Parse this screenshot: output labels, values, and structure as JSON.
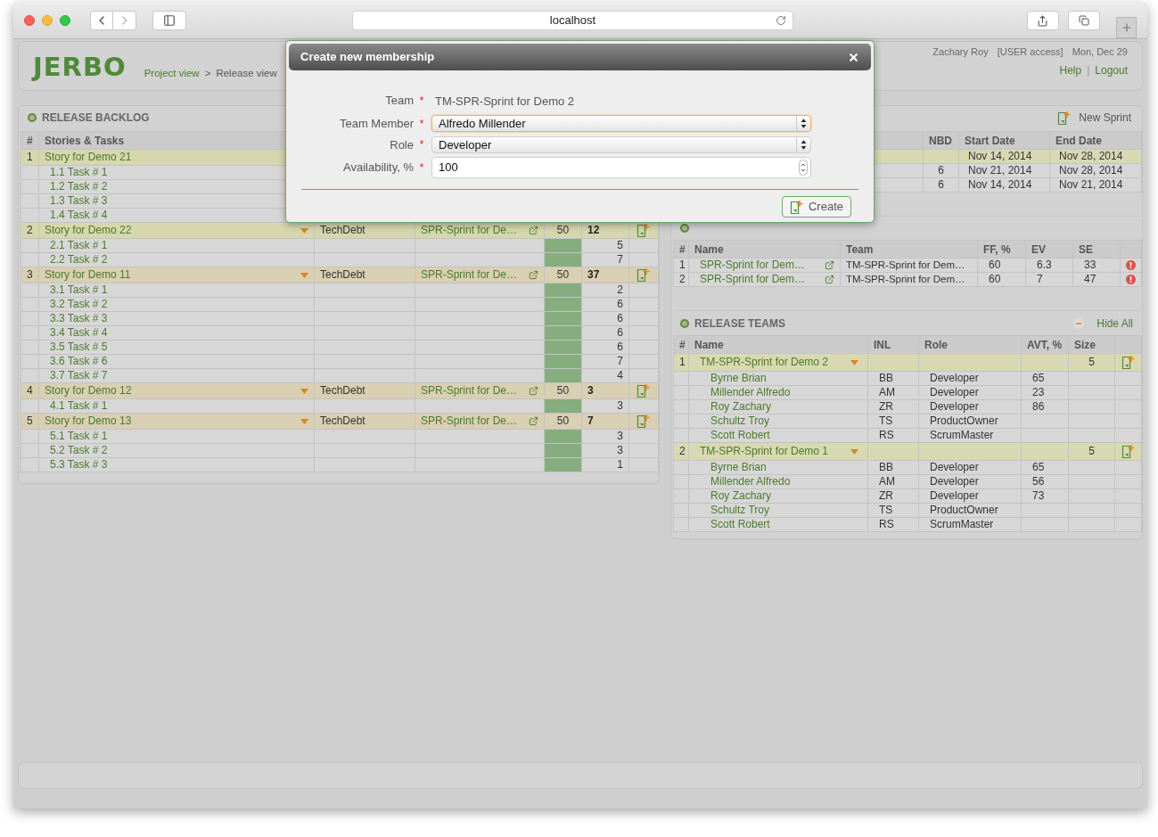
{
  "browser": {
    "address": "localhost"
  },
  "header": {
    "logo": "JERBO",
    "breadcrumb": [
      "Project view",
      "Release view"
    ],
    "breadcrumb_separator": ">",
    "user": "Zachary Roy",
    "access": "[USER access]",
    "date": "Mon, Dec 29",
    "links": [
      "Help",
      "Logout"
    ],
    "link_separator": "|"
  },
  "backlog": {
    "title": "RELEASE BACKLOG",
    "columns": [
      "#",
      "Stories & Tasks"
    ],
    "stories": [
      {
        "number": "1",
        "name": "Story for Demo 21",
        "color": "#d6d7ae",
        "tasks": [
          {
            "name": "1.1 Task # 1"
          },
          {
            "name": "1.2 Task # 2"
          },
          {
            "name": "1.3 Task # 3"
          },
          {
            "name": "1.4 Task # 4"
          }
        ]
      },
      {
        "number": "2",
        "name": "Story for Demo 22",
        "color": "#d6d7ae",
        "type": "TechDebt",
        "sprint": "SPR-Sprint for De…",
        "capacity": "50",
        "points": "12",
        "tasks": [
          {
            "name": "2.1 Task # 1",
            "points": "5"
          },
          {
            "name": "2.2 Task # 2",
            "points": "7"
          }
        ]
      },
      {
        "number": "3",
        "name": "Story for Demo 11",
        "color": "#d9cfb2",
        "type": "TechDebt",
        "sprint": "SPR-Sprint for De…",
        "capacity": "50",
        "points": "37",
        "tasks": [
          {
            "name": "3.1 Task # 1",
            "points": "2"
          },
          {
            "name": "3.2 Task # 2",
            "points": "6"
          },
          {
            "name": "3.3 Task # 3",
            "points": "6"
          },
          {
            "name": "3.4 Task # 4",
            "points": "6"
          },
          {
            "name": "3.5 Task # 5",
            "points": "6"
          },
          {
            "name": "3.6 Task # 6",
            "points": "7"
          },
          {
            "name": "3.7 Task # 7",
            "points": "4"
          }
        ]
      },
      {
        "number": "4",
        "name": "Story for Demo 12",
        "color": "#d9cfb2",
        "type": "TechDebt",
        "sprint": "SPR-Sprint for De…",
        "capacity": "50",
        "points": "3",
        "tasks": [
          {
            "name": "4.1 Task # 1",
            "points": "3"
          }
        ]
      },
      {
        "number": "5",
        "name": "Story for Demo 13",
        "color": "#d9cfb2",
        "type": "TechDebt",
        "sprint": "SPR-Sprint for De…",
        "capacity": "50",
        "points": "7",
        "tasks": [
          {
            "name": "5.1 Task # 1",
            "points": "3"
          },
          {
            "name": "5.2 Task # 2",
            "points": "3"
          },
          {
            "name": "5.3 Task # 3",
            "points": "1"
          }
        ]
      }
    ]
  },
  "sprints": {
    "new_button": "New Sprint",
    "columns": [
      "NBD",
      "Start Date",
      "End Date"
    ],
    "rows": [
      {
        "start": "Nov 14, 2014",
        "end": "Nov 28, 2014",
        "selected": true
      },
      {
        "nbd": "6",
        "start": "Nov 21, 2014",
        "end": "Nov 28, 2014",
        "selected": false
      },
      {
        "nbd": "6",
        "start": "Nov 14, 2014",
        "end": "Nov 21, 2014",
        "selected": false
      }
    ]
  },
  "release_sprints": {
    "columns": [
      "#",
      "Name",
      "Team",
      "FF, %",
      "EV",
      "SE"
    ],
    "rows": [
      {
        "number": "1",
        "name": "SPR-Sprint for Dem…",
        "team": "TM-SPR-Sprint for Dem…",
        "ff": "60",
        "ev": "6.3",
        "se": "33"
      },
      {
        "number": "2",
        "name": "SPR-Sprint for Dem…",
        "team": "TM-SPR-Sprint for Dem…",
        "ff": "60",
        "ev": "7",
        "se": "47"
      }
    ]
  },
  "release_teams": {
    "title": "RELEASE TEAMS",
    "hide_all": "Hide All",
    "columns": [
      "#",
      "Name",
      "INL",
      "Role",
      "AVT, %",
      "Size"
    ],
    "teams": [
      {
        "number": "1",
        "name": "TM-SPR-Sprint for Demo 2",
        "size": "5",
        "members": [
          {
            "name": "Byrne Brian",
            "initials": "BB",
            "role": "Developer",
            "availability": "65"
          },
          {
            "name": "Millender Alfredo",
            "initials": "AM",
            "role": "Developer",
            "availability": "23"
          },
          {
            "name": "Roy Zachary",
            "initials": "ZR",
            "role": "Developer",
            "availability": "86"
          },
          {
            "name": "Schultz Troy",
            "initials": "TS",
            "role": "ProductOwner"
          },
          {
            "name": "Scott Robert",
            "initials": "RS",
            "role": "ScrumMaster"
          }
        ]
      },
      {
        "number": "2",
        "name": "TM-SPR-Sprint for Demo 1",
        "size": "5",
        "members": [
          {
            "name": "Byrne Brian",
            "initials": "BB",
            "role": "Developer",
            "availability": "65"
          },
          {
            "name": "Millender Alfredo",
            "initials": "AM",
            "role": "Developer",
            "availability": "56"
          },
          {
            "name": "Roy Zachary",
            "initials": "ZR",
            "role": "Developer",
            "availability": "73"
          },
          {
            "name": "Schultz Troy",
            "initials": "TS",
            "role": "ProductOwner"
          },
          {
            "name": "Scott Robert",
            "initials": "RS",
            "role": "ScrumMaster"
          }
        ]
      }
    ]
  },
  "dialog": {
    "title": "Create new membership",
    "button": "Create",
    "required_mark": "*",
    "fields": [
      {
        "label": "Team",
        "kind": "text",
        "value": "TM-SPR-Sprint for Demo 2",
        "required": true
      },
      {
        "label": "Team Member",
        "kind": "select",
        "value": "Alfredo Millender",
        "required": true,
        "focused": true
      },
      {
        "label": "Role",
        "kind": "select",
        "value": "Developer",
        "required": true,
        "focused": false
      },
      {
        "label": "Availability, %",
        "kind": "number",
        "value": "100",
        "required": true,
        "focused": false
      }
    ]
  }
}
